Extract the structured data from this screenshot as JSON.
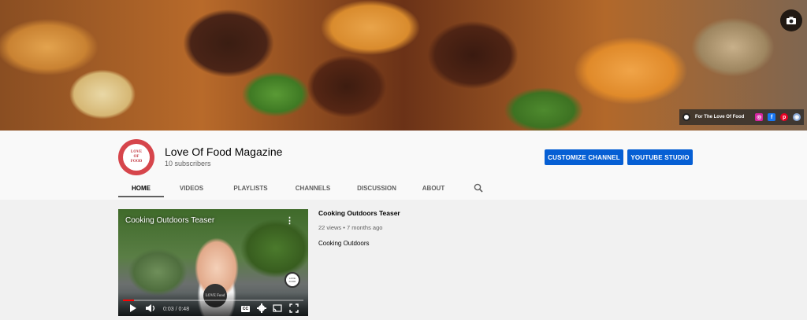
{
  "banner": {
    "links_text": "For The Love Of Food",
    "social_icons": [
      "instagram-icon",
      "facebook-icon",
      "pinterest-icon",
      "website-icon"
    ],
    "social_colors": [
      "#d6249f",
      "#1877f2",
      "#e60023",
      "#8aa8d6"
    ]
  },
  "channel": {
    "name": "Love Of Food Magazine",
    "subscribers": "10 subscribers",
    "avatar_lines": [
      "LOVE",
      "OF",
      "FOOD"
    ]
  },
  "buttons": {
    "customize": "CUSTOMIZE CHANNEL",
    "studio": "YOUTUBE STUDIO"
  },
  "tabs": [
    {
      "label": "HOME",
      "active": true
    },
    {
      "label": "VIDEOS",
      "active": false
    },
    {
      "label": "PLAYLISTS",
      "active": false
    },
    {
      "label": "CHANNELS",
      "active": false
    },
    {
      "label": "DISCUSSION",
      "active": false
    },
    {
      "label": "ABOUT",
      "active": false
    }
  ],
  "featured_video": {
    "player_title": "Cooking Outdoors Teaser",
    "time": "0:03 / 0:48",
    "progress_fraction": 0.0625,
    "cc_label": "CC",
    "apron_text": "LOVE Food",
    "title": "Cooking Outdoors Teaser",
    "meta": "22 views • 7 months ago",
    "description": "Cooking Outdoors"
  },
  "colors": {
    "accent": "#065fd4",
    "progress": "#ff0000",
    "avatar": "#d6454b"
  }
}
